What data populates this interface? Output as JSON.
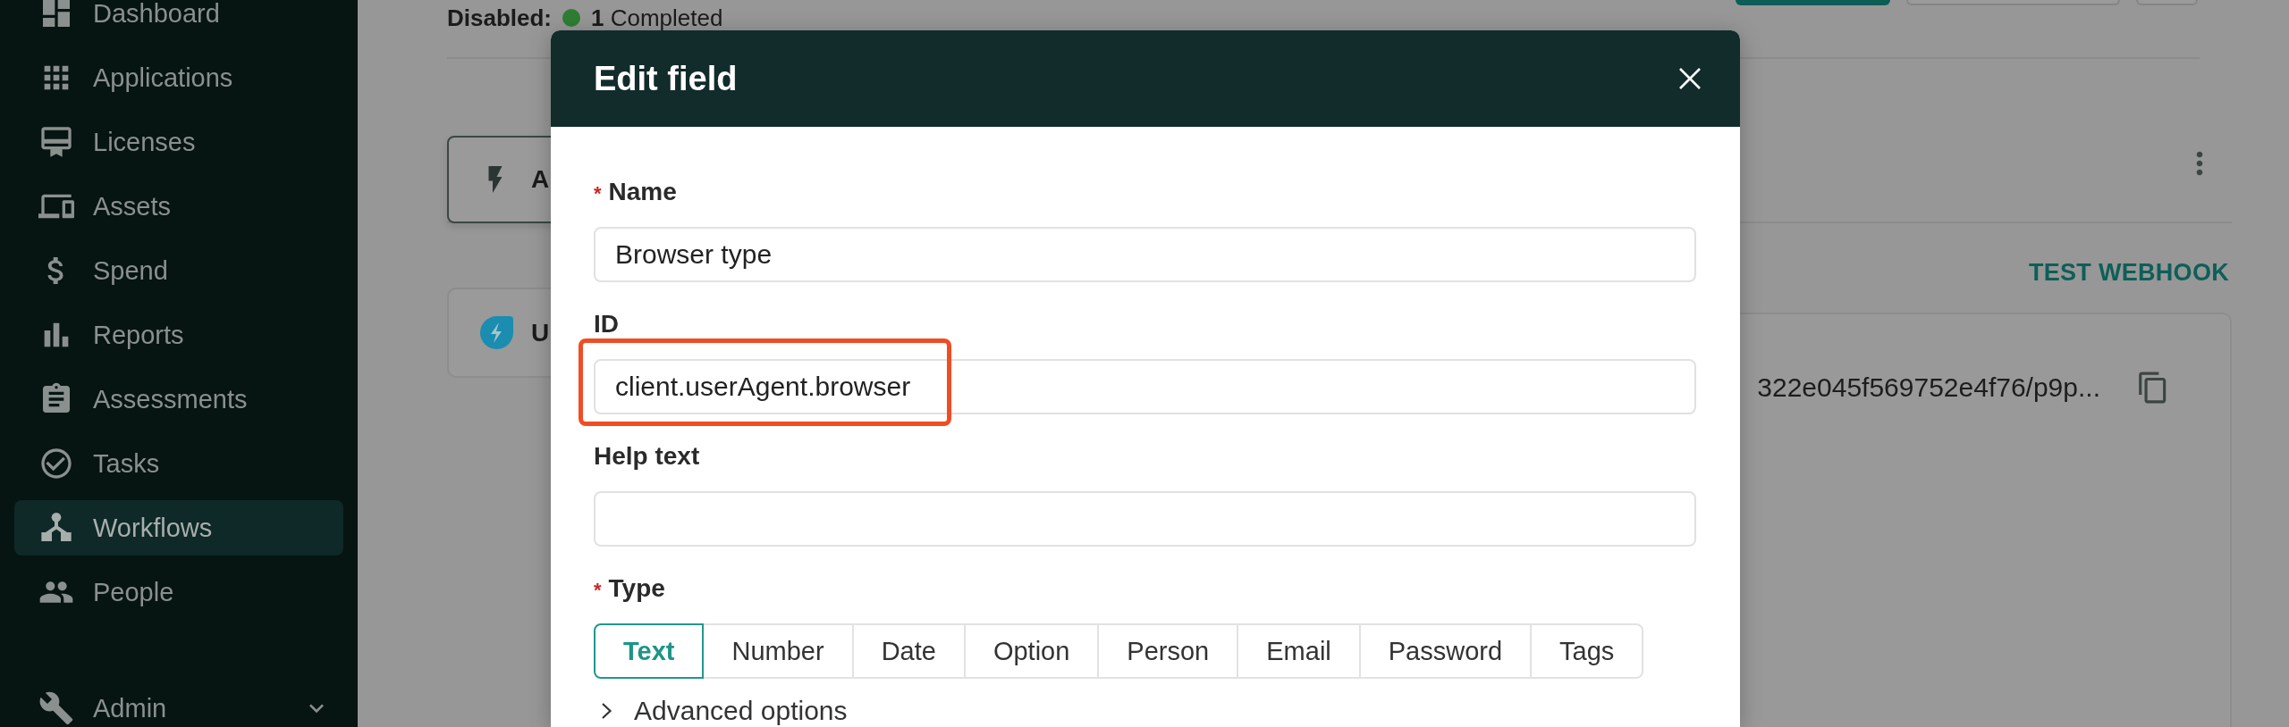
{
  "sidebar": {
    "items": [
      {
        "label": "Dashboard",
        "selected": false
      },
      {
        "label": "Applications",
        "selected": false
      },
      {
        "label": "Licenses",
        "selected": false
      },
      {
        "label": "Assets",
        "selected": false
      },
      {
        "label": "Spend",
        "selected": false
      },
      {
        "label": "Reports",
        "selected": false
      },
      {
        "label": "Assessments",
        "selected": false
      },
      {
        "label": "Tasks",
        "selected": false
      },
      {
        "label": "Workflows",
        "selected": true
      },
      {
        "label": "People",
        "selected": false
      }
    ],
    "admin": {
      "label": "Admin"
    }
  },
  "workflow": {
    "status_label": "Disabled:",
    "status_text": "**1** Completed",
    "trigger_card": {
      "title": "A"
    },
    "step_card": {
      "title": "U"
    },
    "test_webhook": "TEST WEBHOOK",
    "webhook_url": "322e045f569752e4f76/p9p..."
  },
  "dialog": {
    "title": "Edit field",
    "fields": [
      {
        "label": "Name",
        "required_mark": "*",
        "value": "Browser type",
        "highlighted": false
      },
      {
        "label": "ID",
        "value": "client.userAgent.browser",
        "highlighted": true
      },
      {
        "label": "Help text",
        "highlighted": false
      }
    ],
    "type": {
      "label": "Type",
      "required_mark": "*",
      "options": [
        {
          "label": "Text",
          "selected": true
        },
        {
          "label": "Number",
          "selected": false
        },
        {
          "label": "Date",
          "selected": false
        },
        {
          "label": "Option",
          "selected": false
        },
        {
          "label": "Person",
          "selected": false
        },
        {
          "label": "Email",
          "selected": false
        },
        {
          "label": "Password",
          "selected": false
        },
        {
          "label": "Tags",
          "selected": false
        }
      ]
    },
    "advanced": {
      "label": "Advanced options",
      "expanded": false
    }
  }
}
